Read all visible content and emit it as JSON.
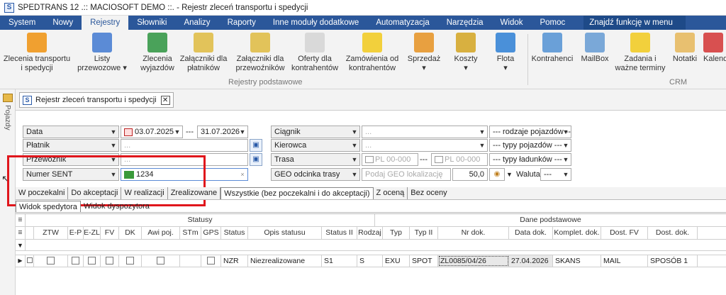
{
  "titlebar": {
    "title": "SPEDTRANS 12 .:: MACIOSOFT DEMO ::. - Rejestr zleceń transportu i spedycji",
    "app_icon": "S"
  },
  "menu": {
    "items": [
      "System",
      "Nowy",
      "Rejestry",
      "Słowniki",
      "Analizy",
      "Raporty",
      "Inne moduły dodatkowe",
      "Automatyzacja",
      "Narzędzia",
      "Widok",
      "Pomoc"
    ],
    "search_placeholder": "Znajdź funkcję w menu"
  },
  "ribbon": {
    "buttons": [
      {
        "label1": "Zlecenia transportu",
        "label2": "i spedycji",
        "icon": "truck-icon",
        "color": "#f0a030"
      },
      {
        "label1": "Listy",
        "label2": "przewozowe ▾",
        "icon": "list-icon",
        "color": "#5b8bd6"
      },
      {
        "label1": "Zlecenia",
        "label2": "wyjazdów",
        "icon": "map-icon",
        "color": "#4aa25a"
      },
      {
        "label1": "Załączniki dla",
        "label2": "płatników",
        "icon": "attachment-icon",
        "color": "#e2c35a"
      },
      {
        "label1": "Załączniki dla",
        "label2": "przewoźników",
        "icon": "attachment-icon",
        "color": "#e2c35a"
      },
      {
        "label1": "Oferty dla",
        "label2": "kontrahentów",
        "icon": "offer-icon",
        "color": "#d9d9d9"
      },
      {
        "label1": "Zamówienia od",
        "label2": "kontrahentów",
        "icon": "order-icon",
        "color": "#f2d03c"
      },
      {
        "label1": "Sprzedaż",
        "label2": "▾",
        "icon": "sales-icon",
        "color": "#e8a040"
      },
      {
        "label1": "Koszty",
        "label2": "▾",
        "icon": "costs-icon",
        "color": "#d8b040"
      },
      {
        "label1": "Flota",
        "label2": "▾",
        "icon": "fleet-icon",
        "color": "#4a90d9"
      },
      {
        "label1": "Kontrahenci",
        "label2": "",
        "icon": "contacts-icon",
        "color": "#6aa0d8"
      },
      {
        "label1": "MailBox",
        "label2": "",
        "icon": "mailbox-icon",
        "color": "#7aa8d8"
      },
      {
        "label1": "Zadania i",
        "label2": "ważne terminy",
        "icon": "tasks-icon",
        "color": "#f2d03c"
      },
      {
        "label1": "Notatki",
        "label2": "",
        "icon": "notes-icon",
        "color": "#e8c070"
      },
      {
        "label1": "Kalend",
        "label2": "",
        "icon": "calendar-icon",
        "color": "#d85050"
      }
    ],
    "group_main": "Rejestry podstawowe",
    "group_crm": "CRM"
  },
  "sidebar": {
    "label": "Pojazdy"
  },
  "doc_tab": {
    "label": "Rejestr zleceń transportu i spedycji"
  },
  "filters": {
    "data_label": "Data",
    "date_from": "03.07.2025",
    "date_sep": "---",
    "date_to": "31.07.2026",
    "platnik_label": "Płatnik",
    "przewoznik_label": "Przewoźnik",
    "numer_sent_label": "Numer SENT",
    "sent_value": "1234",
    "ellipsis": "...",
    "ciagnik_label": "Ciągnik",
    "kierowca_label": "Kierowca",
    "trasa_label": "Trasa",
    "geo_label": "GEO odcinka trasy",
    "pl_from": "PL 00-000",
    "pl_sep": "---",
    "pl_to": "PL 00-000",
    "geo_placeholder": "Podaj GEO lokalizację",
    "geo_value": "50,0",
    "rodzaje": "--- rodzaje pojazdów --",
    "typy_poj": "--- typy pojazdów ---",
    "typy_lad": "--- typy ładunków ---",
    "waluta_label": "Waluta",
    "waluta_value": "---"
  },
  "filter_tabs": [
    "W poczekalni",
    "Do akceptacji",
    "W realizacji",
    "Zrealizowane",
    "Wszystkie (bez poczekalni i do akceptacji)",
    "Z oceną",
    "Bez oceny"
  ],
  "view_tabs": [
    "Widok spedytora",
    "Widok dyspozytora"
  ],
  "grid": {
    "group_statusy": "Statusy",
    "group_dane": "Dane podstawowe",
    "columns": [
      "ZTW",
      "E-P",
      "E-ZL",
      "FV",
      "DK",
      "Awi poj.",
      "STm",
      "GPS",
      "Status",
      "Opis statusu",
      "Status II",
      "Rodzaj",
      "Typ",
      "Typ II",
      "Nr dok.",
      "Data dok.",
      "Komplet. dok.",
      "Dost. FV",
      "Dost. dok."
    ],
    "row": {
      "status": "NZR",
      "opis": "Niezrealizowane",
      "status2": "S1",
      "rodzaj": "S",
      "typ": "EXU",
      "typ2": "SPOT",
      "nr": "ZL0085/04/26",
      "data": "27.04.2026",
      "komplet": "SKANS",
      "dost_fv": "MAIL",
      "dost_dok": "SPOSÓB 1"
    }
  }
}
